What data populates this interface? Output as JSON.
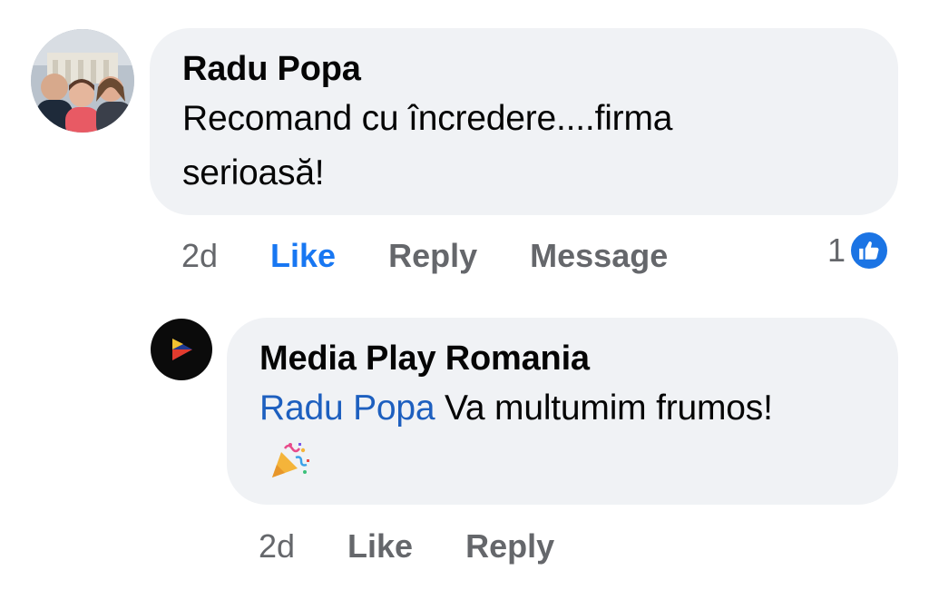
{
  "comment": {
    "author": "Radu Popa",
    "text": "Recomand cu încredere....firma serioasă!",
    "time": "2d",
    "like_label": "Like",
    "reply_label": "Reply",
    "message_label": "Message",
    "reaction_count": "1",
    "reaction_icon": "thumbs-up-icon",
    "like_color": "#1877f2"
  },
  "reply": {
    "author": "Media Play Romania",
    "mention": "Radu Popa",
    "text": "Va multumim frumos!",
    "emoji_icon": "party-popper-icon",
    "time": "2d",
    "like_label": "Like",
    "reply_label": "Reply"
  },
  "colors": {
    "bubble": "#f0f2f5",
    "meta": "#65676b",
    "link": "#1d5fbf",
    "reaction_badge": "#1b74e4"
  }
}
